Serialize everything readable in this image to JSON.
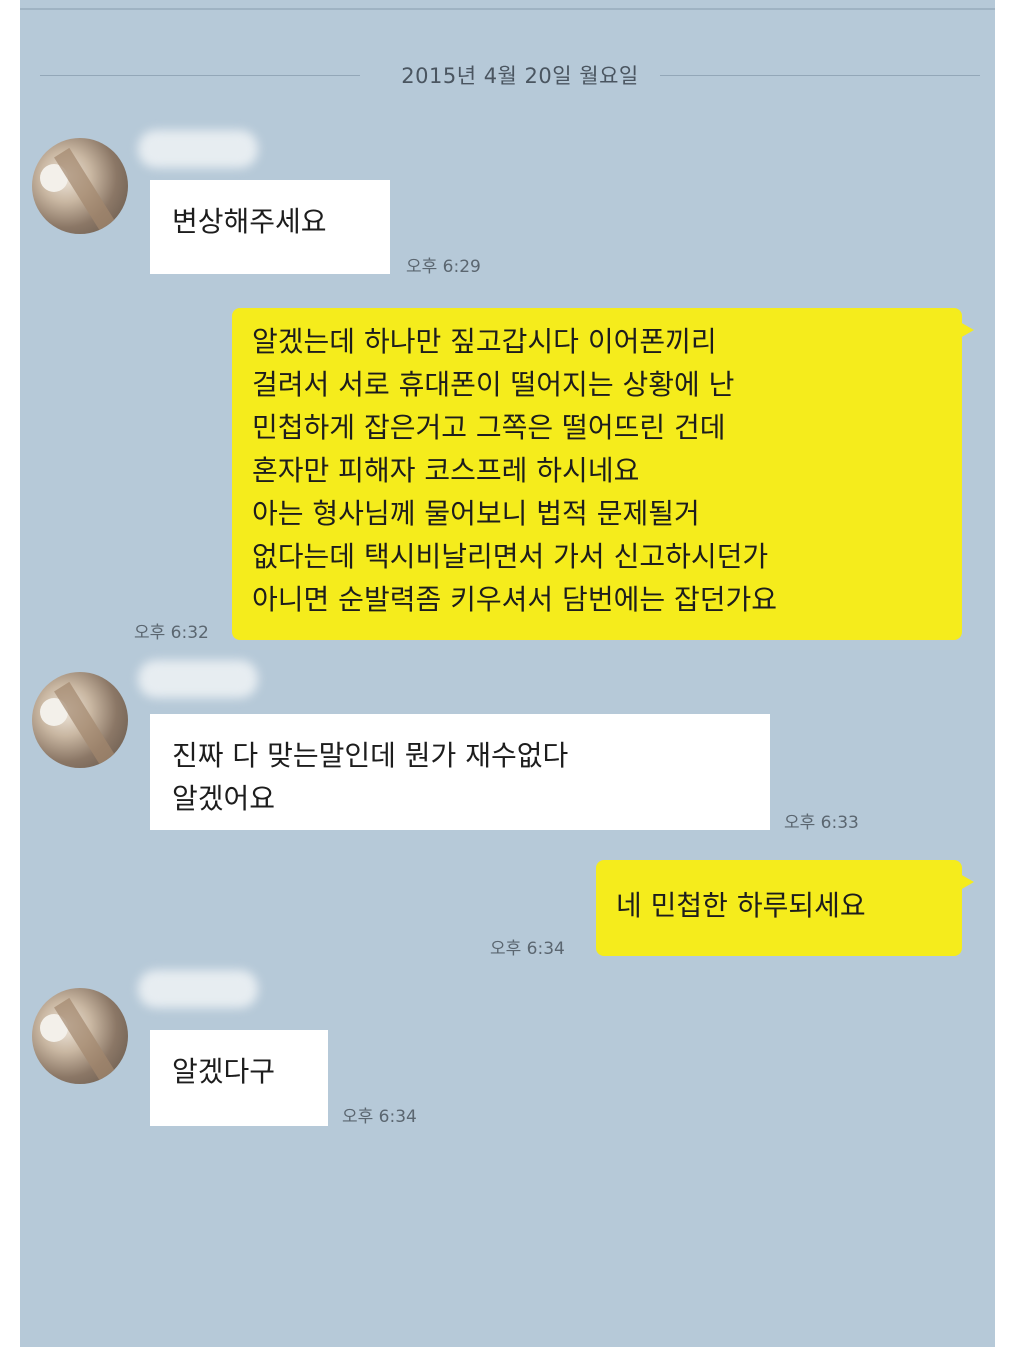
{
  "date_separator": "2015년 4월 20일 월요일",
  "messages": [
    {
      "text": "변상해주세요",
      "time": "오후 6:29"
    },
    {
      "text": "알겠는데 하나만 짚고갑시다 이어폰끼리\n걸려서 서로 휴대폰이 떨어지는 상황에 난\n민첩하게 잡은거고 그쪽은 떨어뜨린 건데\n혼자만 피해자 코스프레 하시네요\n아는 형사님께 물어보니 법적 문제될거\n없다는데 택시비날리면서 가서 신고하시던가\n아니면 순발력좀 키우셔서 담번에는 잡던가요",
      "time": "오후 6:32"
    },
    {
      "text": "진짜 다 맞는말인데 뭔가 재수없다\n알겠어요",
      "time": "오후 6:33"
    },
    {
      "text": "네 민첩한 하루되세요",
      "time": "오후 6:34"
    },
    {
      "text": "알겠다구",
      "time": "오후 6:34"
    }
  ],
  "colors": {
    "background": "#b6c9d8",
    "incoming_bubble": "#ffffff",
    "outgoing_bubble": "#f5ec1c"
  }
}
